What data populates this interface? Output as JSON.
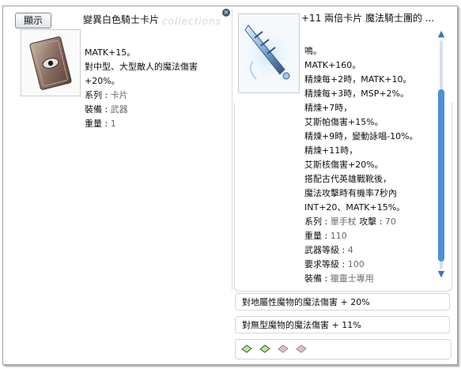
{
  "left": {
    "show_button": "顯示",
    "title": "變異白色騎士卡片",
    "watermark": "collections",
    "description": [
      "MATK+15。",
      "對中型、大型敵人的魔法傷害",
      "+20%。"
    ],
    "stats": [
      {
        "label": "系列",
        "value": "卡片"
      },
      {
        "label": "裝備",
        "value": "武器"
      },
      {
        "label": "重量",
        "value": "1"
      }
    ]
  },
  "right": {
    "title": "+11 兩倍卡片 魔法騎士團的 ...",
    "description": [
      "鳴。",
      "MATK+160。",
      "精煉每+2時，MATK+10。",
      "精煉每+3時，MSP+2%。",
      "精煉+7時，",
      "艾斯帕傷害+15%。",
      "精煉+9時，變動詠唱-10%。",
      "精煉+11時，",
      "艾斯核傷害+20%。",
      "搭配古代英雄戰靴後，",
      "魔法攻擊時有機率7秒內",
      "INT+20、MATK+15%。"
    ],
    "stats": [
      {
        "label": "系列",
        "value": "單手杖",
        "extra_label": "攻擊",
        "extra_value": "70"
      },
      {
        "label": "重量",
        "value": "110"
      },
      {
        "label": "武器等級",
        "value": "4"
      },
      {
        "label": "要求等級",
        "value": "100"
      },
      {
        "label": "裝備",
        "value": "獵靈士專用"
      }
    ],
    "options": [
      "對地屬性魔物的魔法傷害 + 20%",
      "對無型魔物的魔法傷害 + 11%"
    ]
  },
  "colors": {
    "scroll_thumb": "#4d8fd8",
    "border": "#d3d7dc"
  },
  "icons": {
    "close": "close-icon",
    "card": "card-icon",
    "weapon": "staff-icon",
    "slot": "card-slot-icon"
  }
}
